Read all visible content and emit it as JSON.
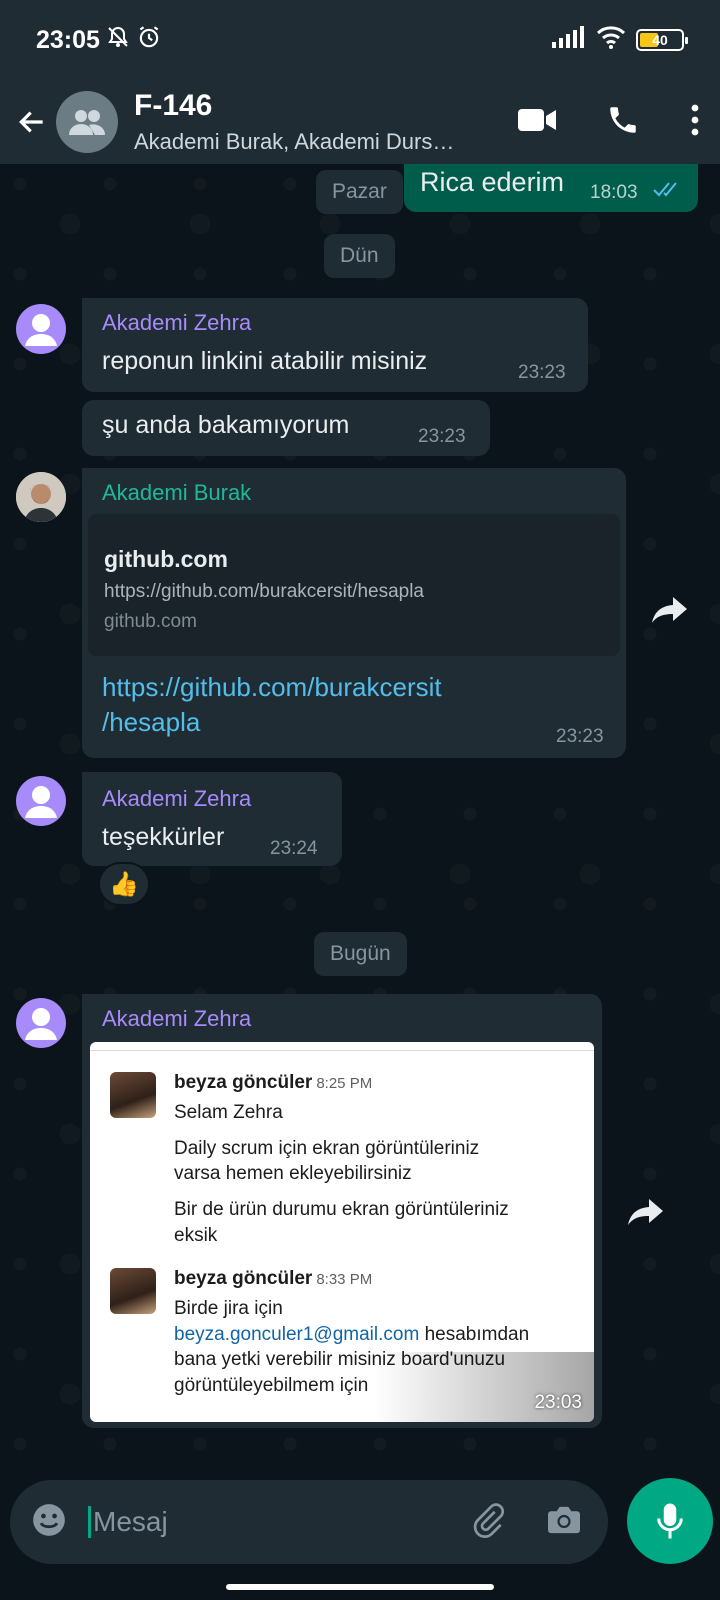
{
  "status_bar": {
    "time": "23:05",
    "battery": "40"
  },
  "header": {
    "title": "F-146",
    "subtitle": "Akademi Burak, Akademi Durs…"
  },
  "chat": {
    "date_pazar": "Pazar",
    "outgoing": {
      "text": "Rica ederim",
      "time": "18:03"
    },
    "date_dun": "Dün",
    "msg1": {
      "sender": "Akademi Zehra",
      "text": "reponun linkini atabilir misiniz",
      "time": "23:23"
    },
    "msg2": {
      "text": "şu anda bakamıyorum",
      "time": "23:23"
    },
    "msg3": {
      "sender": "Akademi Burak",
      "preview_title": "github.com",
      "preview_url": "https://github.com/burakcersit/hesapla",
      "preview_domain": "github.com",
      "link_line1": "https://github.com/burakcersit",
      "link_line2": "/hesapla",
      "time": "23:23"
    },
    "msg4": {
      "sender": "Akademi Zehra",
      "text": "teşekkürler",
      "time": "23:24",
      "reaction": "👍"
    },
    "date_bugun": "Bugün",
    "msg5": {
      "sender": "Akademi Zehra",
      "time": "23:03",
      "screenshot": {
        "m1_name": "beyza göncüler",
        "m1_time": "8:25 PM",
        "m1_line1": "Selam Zehra",
        "m1_line2": "Daily scrum için ekran görüntüleriniz",
        "m1_line3": "varsa hemen ekleyebilirsiniz",
        "m1_line4": "Bir de ürün durumu ekran görüntüleriniz",
        "m1_line5": "eksik",
        "m2_name": "beyza göncüler",
        "m2_time": "8:33 PM",
        "m2_line1": "Birde jira için",
        "m2_email": "beyza.gonculer1@gmail.com",
        "m2_line2_rest": " hesabımdan",
        "m2_line3": "bana yetki verebilir misiniz board'unuzu",
        "m2_line4": "görüntüleyebilmem için"
      }
    }
  },
  "input": {
    "placeholder": "Mesaj"
  },
  "colors": {
    "accent": "#00a884",
    "zehra": "#a78bfa",
    "burak": "#1fb89a",
    "link": "#53bdeb"
  }
}
